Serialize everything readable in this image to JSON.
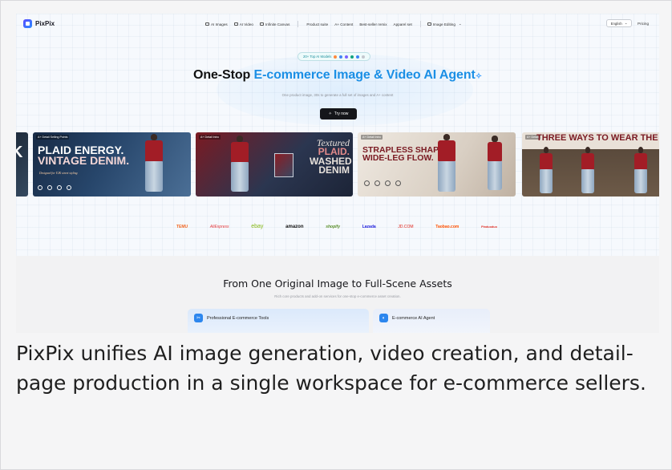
{
  "nav": {
    "brand": "PixPix",
    "links": [
      "AI Images",
      "AI Video",
      "Infinite Canvas",
      "Product suite",
      "A+ Content",
      "Best-seller remix",
      "Apparel set",
      "Image Editing"
    ],
    "language": "English",
    "pricing": "Pricing"
  },
  "hero": {
    "pill": "20+ Top AI Models",
    "headline_prefix": "One-Stop ",
    "headline_accent": "E-commerce Image & Video AI Agent",
    "subline": "One product image, 30s to generate a full set of images and A+ content",
    "cta": "Try now"
  },
  "cards": [
    {
      "tag": "",
      "line1": "K",
      "line2": "",
      "sub": ""
    },
    {
      "tag": "A+ Detail Selling Points",
      "line1": "PLAID ENERGY.",
      "line2": "VINTAGE DENIM.",
      "sub": "Designed for Y2K street styling"
    },
    {
      "tag": "A+ Detail Intro",
      "line1": "Textured",
      "line2": "PLAID.",
      "line3": "WASHED",
      "line4": "DENIM"
    },
    {
      "tag": "A+ Detail Intro",
      "line1": "STRAPLESS SHAPE.",
      "line2": "WIDE-LEG FLOW."
    },
    {
      "tag": "A+ Detail",
      "line1": "THREE WAYS TO WEAR THE SET"
    }
  ],
  "brands": [
    "TEMU",
    "AliExpress",
    "ebay",
    "amazon",
    "shopify",
    "Lazada",
    "JD.COM",
    "Taobao.com",
    "Pinduoduo"
  ],
  "section2": {
    "title": "From One Original Image to Full-Scene Assets",
    "subtitle": "Rich core products and add-on services for one-stop e-commerce asset creation.",
    "tools": [
      "Professional E-commerce Tools",
      "E-commerce AI Agent"
    ]
  },
  "caption": "PixPix unifies AI image generation, video creation, and detail-page production in a single workspace for e-commerce sellers.",
  "colors": {
    "accent": "#1b8fe5",
    "cta": "#15161a",
    "denim": "#a9bccf",
    "plaid": "#a21d26"
  }
}
